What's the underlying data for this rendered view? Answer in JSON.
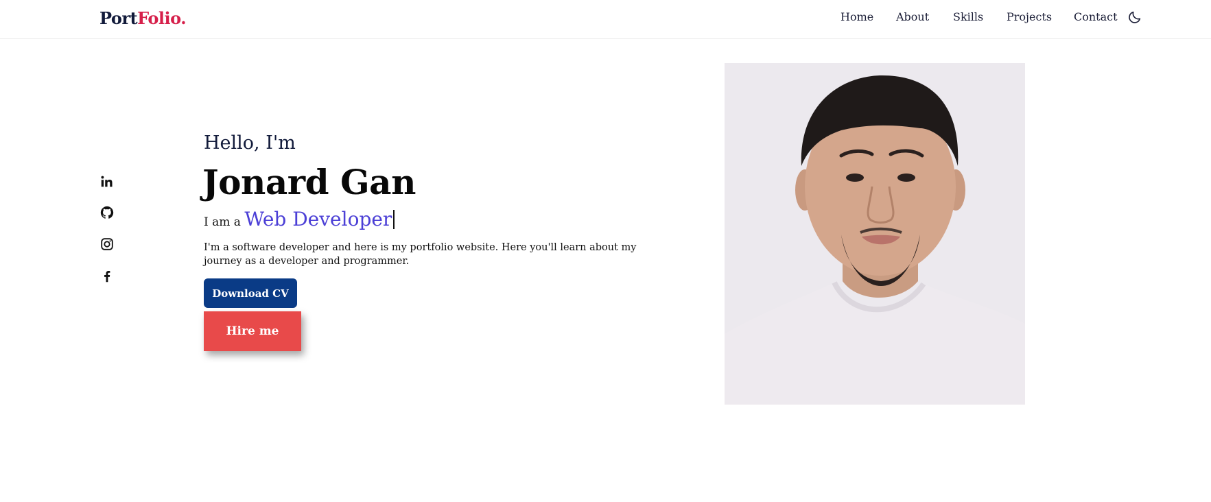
{
  "brand": {
    "part1": "Port",
    "part2": "Folio."
  },
  "nav": {
    "items": [
      {
        "label": "Home"
      },
      {
        "label": "About"
      },
      {
        "label": "Skills"
      },
      {
        "label": "Projects"
      },
      {
        "label": "Contact"
      }
    ],
    "theme_toggle_icon": "moon-icon"
  },
  "social": [
    "linkedin-icon",
    "github-icon",
    "instagram-icon",
    "facebook-icon"
  ],
  "hero": {
    "greeting": "Hello, I'm",
    "name": "Jonard Gan",
    "role_prefix": "I am a",
    "role": "Web Developer",
    "bio": "I'm a software developer and here is my portfolio website. Here you'll learn about my journey as a developer and programmer.",
    "download_label": "Download CV",
    "hire_label": "Hire me"
  },
  "colors": {
    "brand_dark": "#111a3a",
    "brand_accent": "#d61f4a",
    "role_color": "#4b3fd6",
    "download_bg": "#0a3b86",
    "hire_bg": "#e84a4a"
  }
}
